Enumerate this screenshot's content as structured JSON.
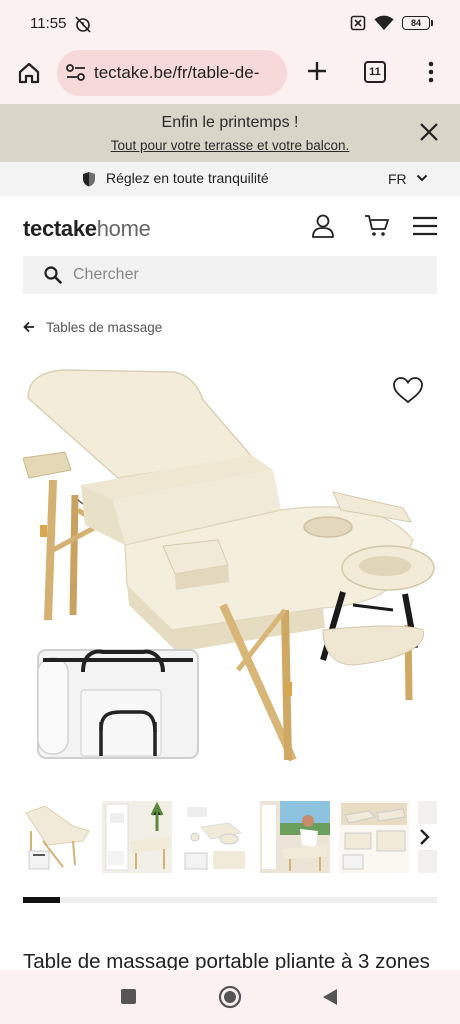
{
  "status": {
    "time": "11:55",
    "battery": "84"
  },
  "browser": {
    "url": "tectake.be/fr/table-de-",
    "tab_count": "11"
  },
  "promo": {
    "title": "Enfin le printemps !",
    "link": "Tout pour votre terrasse et votre balcon."
  },
  "trust": {
    "text": "Réglez en toute tranquilité",
    "language": "FR"
  },
  "header": {
    "logo_bold": "tectake",
    "logo_light": "home"
  },
  "search": {
    "placeholder": "Chercher"
  },
  "breadcrumb": {
    "label": "Tables de massage"
  },
  "gallery": {
    "thumb_count": 6,
    "progress": 0.09
  },
  "product": {
    "title": "Table de massage portable pliante à 3 zones"
  },
  "colors": {
    "cream": "#f1ead8",
    "wood": "#dcbb7f",
    "banner": "#d9d5c9",
    "chrome": "#fcf1f1"
  }
}
